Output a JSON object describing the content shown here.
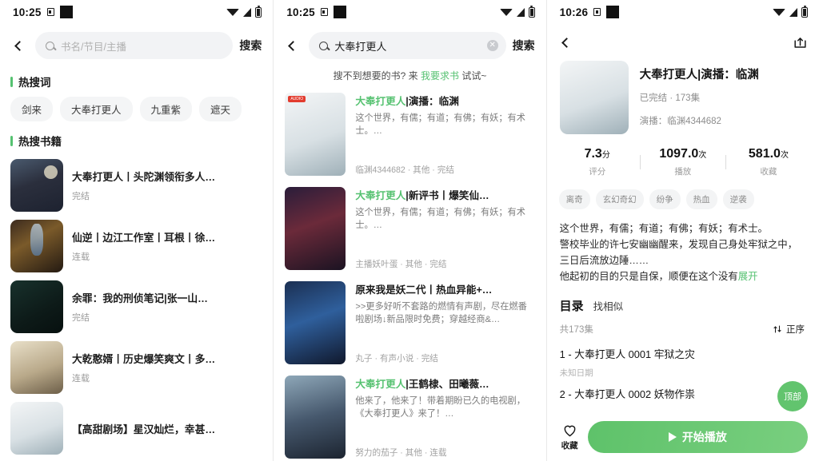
{
  "panel1": {
    "statusbar": {
      "time": "10:25",
      "icons": [
        "sim-icon",
        "block-icon",
        "wifi-icon",
        "signal-icon",
        "battery-icon"
      ]
    },
    "search": {
      "placeholder": "书名/节目/主播",
      "value": "",
      "button_label": "搜索",
      "search_icon": "search-icon",
      "back_icon": "back-chevron-icon"
    },
    "hotwords": {
      "title": "热搜词",
      "chips": [
        "剑来",
        "大奉打更人",
        "九重紫",
        "遮天"
      ]
    },
    "hotbooks": {
      "title": "热搜书籍",
      "items": [
        {
          "title": "大奉打更人丨头陀渊领衔多人…",
          "status": "完结",
          "art": "a1"
        },
        {
          "title": "仙逆丨边江工作室丨耳根丨徐…",
          "status": "连载",
          "art": "a2"
        },
        {
          "title": "余罪：我的刑侦笔记|张一山…",
          "status": "完结",
          "art": "a3"
        },
        {
          "title": "大乾憨婿丨历史爆笑爽文丨多…",
          "status": "连载",
          "art": "a5"
        },
        {
          "title": "【高甜剧场】星汉灿烂，幸甚…",
          "status": "",
          "art": "a6"
        }
      ]
    }
  },
  "panel2": {
    "statusbar": {
      "time": "10:25"
    },
    "search": {
      "value": "大奉打更人",
      "button_label": "搜索",
      "clear_label": "✕"
    },
    "ask": {
      "pre": "搜不到想要的书? 来 ",
      "link": "我要求书",
      "post": " 试试~"
    },
    "results": [
      {
        "highlight": "大奉打更人",
        "rest": "|演播：临渊",
        "desc": "这个世界，有儒；有道；有佛；有妖；有术士。…",
        "footer": "临渊4344682 · 其他 · 完结",
        "art": "a6"
      },
      {
        "highlight": "大奉打更人",
        "rest": "|新评书丨爆笑仙…",
        "desc": "这个世界，有儒；有道；有佛；有妖；有术士。…",
        "footer": "主播妖叶蛋 · 其他 · 完结",
        "art": "a7"
      },
      {
        "highlight": "",
        "rest": "原来我是妖二代丨热血异能+…",
        "desc": ">>更多好听不套路的燃情有声剧，尽在燃番啦剧场↓新品限时免费；穿越经商&…",
        "footer": "丸子 · 有声小说 · 完结",
        "art": "a8"
      },
      {
        "highlight": "大奉打更人",
        "rest": "|王鹤棣、田曦薇…",
        "desc": "他来了，他来了！带着期盼已久的电视剧，《大奉打更人》来了！…",
        "footer": "努力的茄子 · 其他 · 连载",
        "art": "a9"
      }
    ]
  },
  "panel3": {
    "statusbar": {
      "time": "10:26"
    },
    "share_icon": "share-icon",
    "back_icon": "back-chevron-icon",
    "detail": {
      "title": "大奉打更人|演播：临渊",
      "subtitle": "已完结 · 173集",
      "narrator": "演播：临渊4344682",
      "cover_art": "a6"
    },
    "stats": [
      {
        "value": "7.3",
        "unit": "分",
        "label": "评分"
      },
      {
        "value": "1097.0",
        "unit": "次",
        "label": "播放"
      },
      {
        "value": "581.0",
        "unit": "次",
        "label": "收藏"
      }
    ],
    "tags": [
      "离奇",
      "玄幻奇幻",
      "纷争",
      "热血",
      "逆袭"
    ],
    "description": "这个世界，有儒；有道；有佛；有妖；有术士。\n警校毕业的许七安幽幽醒来，发现自己身处牢狱之中，三日后流放边陲……\n他起初的目的只是自保，顺便在这个没有",
    "description_more": "展开",
    "toc": {
      "title": "目录",
      "similar_label": "找相似",
      "count_label": "共173集",
      "sort_label": "正序",
      "sort_icon": "sort-icon",
      "episodes": [
        {
          "title": "1 - 大奉打更人 0001 牢狱之灾",
          "date": "未知日期"
        },
        {
          "title": "2 - 大奉打更人 0002 妖物作祟",
          "date": ""
        }
      ]
    },
    "fab_label": "顶部",
    "bottom": {
      "fav_label": "收藏",
      "fav_icon": "heart-icon",
      "play_label": "开始播放",
      "play_icon": "play-icon"
    }
  },
  "colors": {
    "accent": "#56c271",
    "play_gradient_start": "#5ec26a",
    "play_gradient_end": "#79cf7f",
    "chip_bg": "#f3f4f5"
  }
}
